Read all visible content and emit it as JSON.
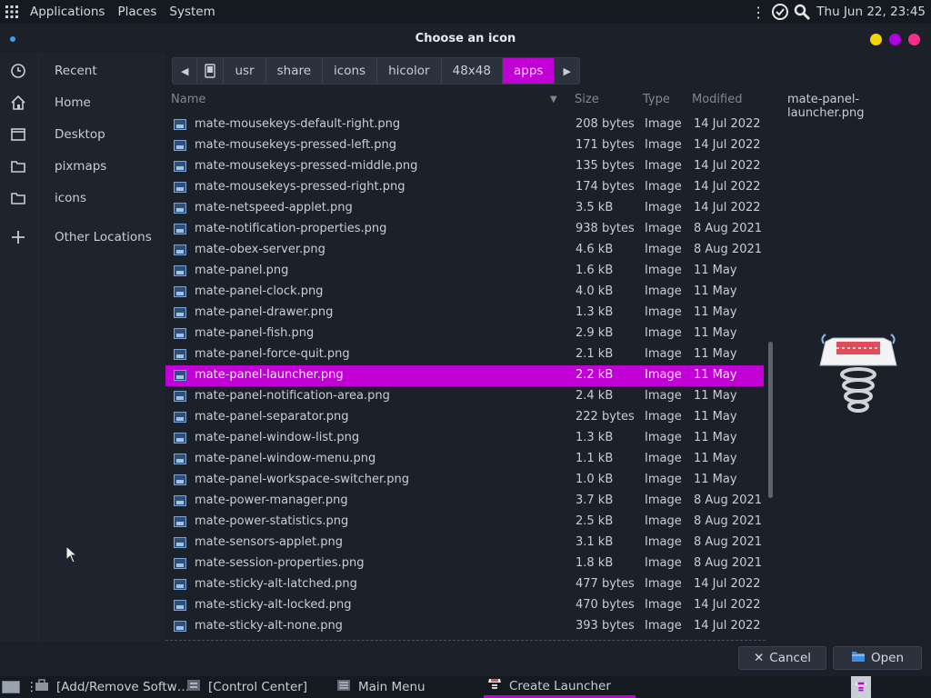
{
  "topbar": {
    "menus": [
      "Applications",
      "Places",
      "System"
    ],
    "clock": "Thu Jun 22, 23:45"
  },
  "dialog": {
    "title": "Choose an icon",
    "buttons": {
      "minimize": "#f5d400",
      "maximize": "#b000e0",
      "close": "#ff2d8a"
    }
  },
  "sidebar": {
    "items": [
      {
        "label": "Recent",
        "icon": "clock-icon"
      },
      {
        "label": "Home",
        "icon": "home-icon"
      },
      {
        "label": "Desktop",
        "icon": "desktop-icon"
      },
      {
        "label": "pixmaps",
        "icon": "folder-icon"
      },
      {
        "label": "icons",
        "icon": "folder-icon"
      },
      {
        "label": "Other Locations",
        "icon": "plus-icon"
      }
    ]
  },
  "pathbar": {
    "segments": [
      "usr",
      "share",
      "icons",
      "hicolor",
      "48x48",
      "apps"
    ],
    "active": "apps"
  },
  "columns": {
    "name": "Name",
    "size": "Size",
    "type": "Type",
    "modified": "Modified"
  },
  "files": [
    {
      "name": "mate-mousekeys-default-right.png",
      "size": "208 bytes",
      "type": "Image",
      "modified": "14 Jul 2022"
    },
    {
      "name": "mate-mousekeys-pressed-left.png",
      "size": "171 bytes",
      "type": "Image",
      "modified": "14 Jul 2022"
    },
    {
      "name": "mate-mousekeys-pressed-middle.png",
      "size": "135 bytes",
      "type": "Image",
      "modified": "14 Jul 2022"
    },
    {
      "name": "mate-mousekeys-pressed-right.png",
      "size": "174 bytes",
      "type": "Image",
      "modified": "14 Jul 2022"
    },
    {
      "name": "mate-netspeed-applet.png",
      "size": "3.5 kB",
      "type": "Image",
      "modified": "14 Jul 2022"
    },
    {
      "name": "mate-notification-properties.png",
      "size": "938 bytes",
      "type": "Image",
      "modified": "8 Aug 2021"
    },
    {
      "name": "mate-obex-server.png",
      "size": "4.6 kB",
      "type": "Image",
      "modified": "8 Aug 2021"
    },
    {
      "name": "mate-panel.png",
      "size": "1.6 kB",
      "type": "Image",
      "modified": "11 May"
    },
    {
      "name": "mate-panel-clock.png",
      "size": "4.0 kB",
      "type": "Image",
      "modified": "11 May"
    },
    {
      "name": "mate-panel-drawer.png",
      "size": "1.3 kB",
      "type": "Image",
      "modified": "11 May"
    },
    {
      "name": "mate-panel-fish.png",
      "size": "2.9 kB",
      "type": "Image",
      "modified": "11 May"
    },
    {
      "name": "mate-panel-force-quit.png",
      "size": "2.1 kB",
      "type": "Image",
      "modified": "11 May"
    },
    {
      "name": "mate-panel-launcher.png",
      "size": "2.2 kB",
      "type": "Image",
      "modified": "11 May",
      "selected": true
    },
    {
      "name": "mate-panel-notification-area.png",
      "size": "2.4 kB",
      "type": "Image",
      "modified": "11 May"
    },
    {
      "name": "mate-panel-separator.png",
      "size": "222 bytes",
      "type": "Image",
      "modified": "11 May"
    },
    {
      "name": "mate-panel-window-list.png",
      "size": "1.3 kB",
      "type": "Image",
      "modified": "11 May"
    },
    {
      "name": "mate-panel-window-menu.png",
      "size": "1.1 kB",
      "type": "Image",
      "modified": "11 May"
    },
    {
      "name": "mate-panel-workspace-switcher.png",
      "size": "1.0 kB",
      "type": "Image",
      "modified": "11 May"
    },
    {
      "name": "mate-power-manager.png",
      "size": "3.7 kB",
      "type": "Image",
      "modified": "8 Aug 2021"
    },
    {
      "name": "mate-power-statistics.png",
      "size": "2.5 kB",
      "type": "Image",
      "modified": "8 Aug 2021"
    },
    {
      "name": "mate-sensors-applet.png",
      "size": "3.1 kB",
      "type": "Image",
      "modified": "8 Aug 2021"
    },
    {
      "name": "mate-session-properties.png",
      "size": "1.8 kB",
      "type": "Image",
      "modified": "8 Aug 2021"
    },
    {
      "name": "mate-sticky-alt-latched.png",
      "size": "477 bytes",
      "type": "Image",
      "modified": "14 Jul 2022"
    },
    {
      "name": "mate-sticky-alt-locked.png",
      "size": "470 bytes",
      "type": "Image",
      "modified": "14 Jul 2022"
    },
    {
      "name": "mate-sticky-alt-none.png",
      "size": "393 bytes",
      "type": "Image",
      "modified": "14 Jul 2022"
    }
  ],
  "preview": {
    "filename": "mate-panel-launcher.png"
  },
  "actions": {
    "cancel": "Cancel",
    "open": "Open"
  },
  "taskbar": {
    "tasks": [
      {
        "label": "[Add/Remove Softw…",
        "active": false
      },
      {
        "label": "[Control Center]",
        "active": false
      },
      {
        "label": "Main Menu",
        "active": false
      },
      {
        "label": "Create Launcher",
        "active": true
      }
    ]
  },
  "colors": {
    "accent": "#c000d4",
    "background": "#1b2029"
  }
}
